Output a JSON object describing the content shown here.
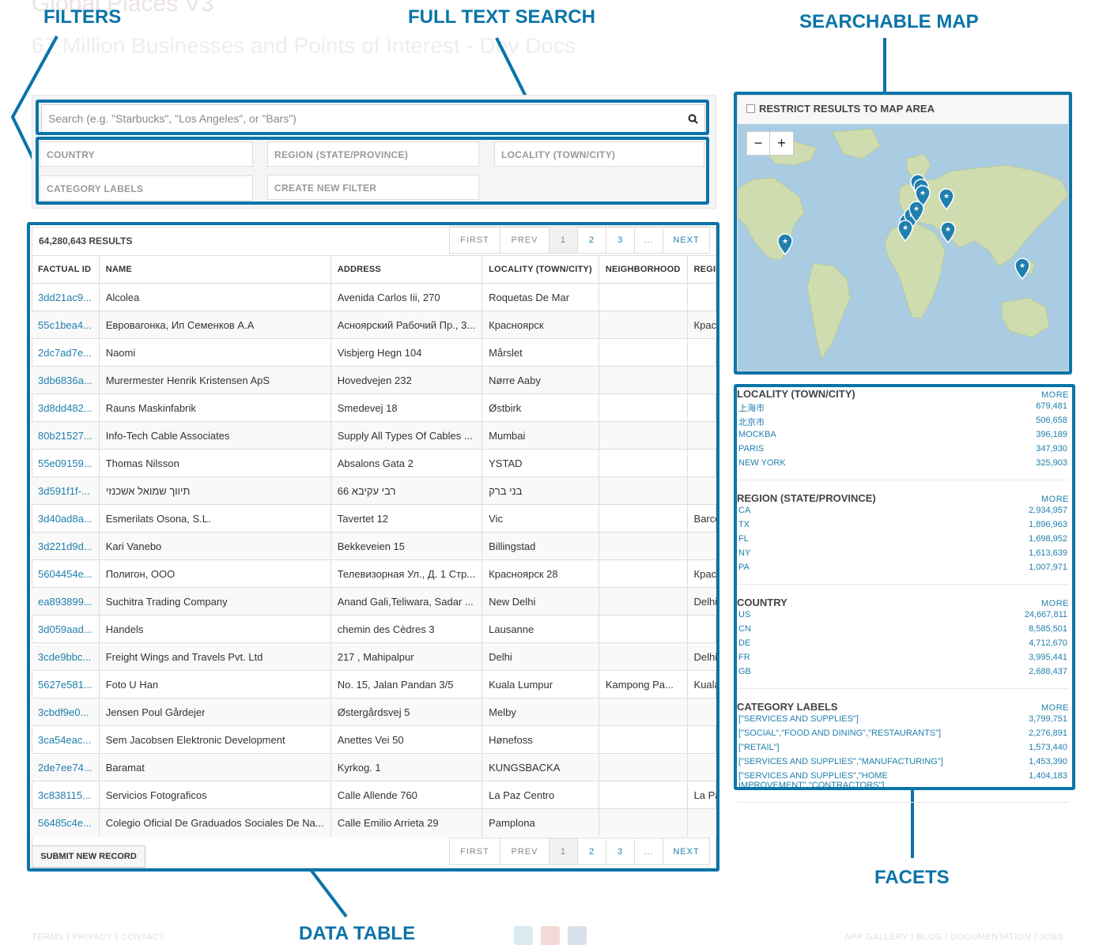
{
  "header": {
    "title": "Global Places V3",
    "subtitle": "67 Million Businesses and Points of Interest - Dev Docs"
  },
  "annotations": {
    "filters": "FILTERS",
    "full_text_search": "FULL TEXT SEARCH",
    "searchable_map": "SEARCHABLE MAP",
    "data_table": "DATA TABLE",
    "facets": "FACETS"
  },
  "search": {
    "placeholder": "Search (e.g. \"Starbucks\", \"Los Angeles\", or \"Bars\")"
  },
  "filters": {
    "country": "COUNTRY",
    "region": "REGION (STATE/PROVINCE)",
    "locality": "LOCALITY (TOWN/CITY)",
    "category": "CATEGORY LABELS",
    "create": "CREATE NEW FILTER"
  },
  "results": {
    "count": "64,280,643 RESULTS",
    "submit": "SUBMIT NEW RECORD"
  },
  "pager": {
    "first": "FIRST",
    "prev": "PREV",
    "p1": "1",
    "p2": "2",
    "p3": "3",
    "ellipsis": "...",
    "next": "NEXT"
  },
  "table": {
    "headers": [
      "FACTUAL ID",
      "NAME",
      "ADDRESS",
      "LOCALITY (TOWN/CITY)",
      "NEIGHBORHOOD",
      "REGION"
    ],
    "rows": [
      [
        "3dd21ac9...",
        "Alcolea",
        "Avenida Carlos Iii, 270",
        "Roquetas De Mar",
        "",
        ""
      ],
      [
        "55c1bea4...",
        "Евроваrонка, Ип Семенков А.А",
        "Асноярский Рабочий Пр., 3...",
        "Красноярск",
        "",
        "Крас"
      ],
      [
        "2dc7ad7e...",
        "Naomi",
        "Visbjerg Hegn 104",
        "Mårslet",
        "",
        ""
      ],
      [
        "3db6836a...",
        "Murermester Henrik Kristensen ApS",
        "Hovedvejen 232",
        "Nørre Aaby",
        "",
        ""
      ],
      [
        "3d8dd482...",
        "Rauns Maskinfabrik",
        "Smedevej 18",
        "Østbirk",
        "",
        ""
      ],
      [
        "80b21527...",
        "Info-Tech Cable Associates",
        "Supply All Types Of Cables ...",
        "Mumbai",
        "",
        ""
      ],
      [
        "55e09159...",
        "Thomas Nilsson",
        "Absalons Gata 2",
        "YSTAD",
        "",
        ""
      ],
      [
        "3d591f1f-...",
        "תיווך שמואל אשכנזי",
        "רבי עקיבא 66",
        "בני ברק",
        "",
        ""
      ],
      [
        "3d40ad8a...",
        "Esmerilats Osona, S.L.",
        "Tavertet 12",
        "Vic",
        "",
        "Barce"
      ],
      [
        "3d221d9d...",
        "Kari Vanebo",
        "Bekkeveien 15",
        "Billingstad",
        "",
        ""
      ],
      [
        "5604454e...",
        "Полигон, ООО",
        "Телевизорная Ул., Д. 1 Стр...",
        "Красноярск 28",
        "",
        "Крас"
      ],
      [
        "ea893899...",
        "Suchitra Trading Company",
        "Anand Gali,Teliwara, Sadar ...",
        "New Delhi",
        "",
        "Delhi"
      ],
      [
        "3d059aad...",
        "Handels",
        "chemin des Cèdres 3",
        "Lausanne",
        "",
        ""
      ],
      [
        "3cde9bbc...",
        "Freight Wings and Travels Pvt. Ltd",
        "217 , Mahipalpur",
        "Delhi",
        "",
        "Delhi"
      ],
      [
        "5627e581...",
        "Foto U Han",
        "No. 15, Jalan Pandan 3/5",
        "Kuala Lumpur",
        "Kampong Pa...",
        "Kuala"
      ],
      [
        "3cbdf9e0...",
        "Jensen Poul Gårdejer",
        "Østergårdsvej 5",
        "Melby",
        "",
        ""
      ],
      [
        "3ca54eac...",
        "Sem Jacobsen Elektronic Development",
        "Anettes Vei 50",
        "Hønefoss",
        "",
        ""
      ],
      [
        "2de7ee74...",
        "Baramat",
        "Kyrkog. 1",
        "KUNGSBACKA",
        "",
        ""
      ],
      [
        "3c838115...",
        "Servicios Fotograficos",
        "Calle Allende 760",
        "La Paz Centro",
        "",
        "La Pa"
      ],
      [
        "56485c4e...",
        "Colegio Oficial De Graduados Sociales De Na...",
        "Calle Emilio Arrieta 29",
        "Pamplona",
        "",
        ""
      ]
    ]
  },
  "map": {
    "restrict_label": "RESTRICT RESULTS TO MAP AREA",
    "zoom_out": "−",
    "zoom_in": "+",
    "ocean_color": "#a9cce3",
    "land_color": "#cfdcb0",
    "marker_color": "#1f7fae"
  },
  "facets": [
    {
      "title": "LOCALITY (TOWN/CITY)",
      "more": "MORE",
      "items": [
        [
          "上海市",
          "679,481"
        ],
        [
          "北京市",
          "506,658"
        ],
        [
          "MOCKBA",
          "396,189"
        ],
        [
          "PARIS",
          "347,930"
        ],
        [
          "NEW YORK",
          "325,903"
        ]
      ]
    },
    {
      "title": "REGION (STATE/PROVINCE)",
      "more": "MORE",
      "items": [
        [
          "CA",
          "2,934,957"
        ],
        [
          "TX",
          "1,896,963"
        ],
        [
          "FL",
          "1,698,952"
        ],
        [
          "NY",
          "1,613,639"
        ],
        [
          "PA",
          "1,007,971"
        ]
      ]
    },
    {
      "title": "COUNTRY",
      "more": "MORE",
      "items": [
        [
          "US",
          "24,667,811"
        ],
        [
          "CN",
          "8,585,501"
        ],
        [
          "DE",
          "4,712,670"
        ],
        [
          "FR",
          "3,995,441"
        ],
        [
          "GB",
          "2,688,437"
        ]
      ]
    },
    {
      "title": "CATEGORY LABELS",
      "more": "MORE",
      "items": [
        [
          "[\"SERVICES AND SUPPLIES\"]",
          "3,799,751"
        ],
        [
          "[\"SOCIAL\",\"FOOD AND DINING\",\"RESTAURANTS\"]",
          "2,276,891"
        ],
        [
          "[\"RETAIL\"]",
          "1,573,440"
        ],
        [
          "[\"SERVICES AND SUPPLIES\",\"MANUFACTURING\"]",
          "1,453,390"
        ],
        [
          "[\"SERVICES AND SUPPLIES\",\"HOME IMPROVEMENT\",\"CONTRACTORS\"]",
          "1,404,183"
        ]
      ]
    }
  ],
  "footer": {
    "terms": "TERMS",
    "privacy": "PRIVACY",
    "contact": "CONTACT",
    "app_gallery": "APP GALLERY",
    "blog": "BLOG",
    "documentation": "DOCUMENTATION",
    "jobs": "JOBS",
    "social_icons": [
      "twitter-icon",
      "google-plus-icon",
      "facebook-icon"
    ]
  },
  "colors": {
    "annotation": "#0a74a8",
    "link": "#1f7fae"
  }
}
